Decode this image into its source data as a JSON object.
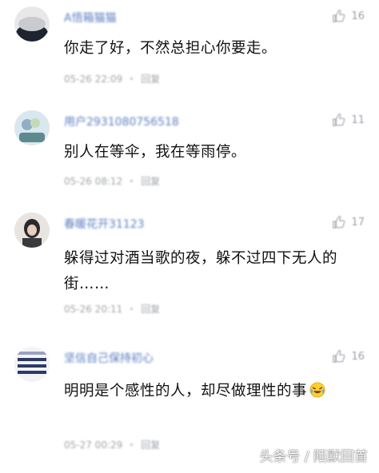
{
  "comments": [
    {
      "username": "A悟箱猫猫",
      "likes": "16",
      "text": "你走了好，不然总担心你要走。",
      "timestamp": "05-26 22:09",
      "reply": "回复"
    },
    {
      "username": "用户2931080756518",
      "likes": "11",
      "text": "别人在等伞，我在等雨停。",
      "timestamp": "05-26 08:12",
      "reply": "回复"
    },
    {
      "username": "春暖花开31123",
      "likes": "17",
      "text": "躲得过对酒当歌的夜，躲不过四下无人的街……",
      "timestamp": "05-26 20:11",
      "reply": "回复"
    },
    {
      "username": "坚信自己保持初心",
      "likes": "16",
      "text": "明明是个感性的人，却尽做理性的事",
      "emoji": "crying-laughing-emoji",
      "timestamp": "05-27 00:29",
      "reply": "回复"
    }
  ],
  "watermark": "头条号 / 陌默回首",
  "colors": {
    "username": "#5a7dc0",
    "text": "#111111",
    "meta": "#a0a4aa"
  }
}
